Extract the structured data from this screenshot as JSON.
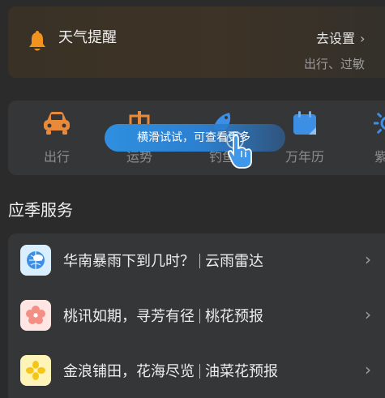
{
  "reminder": {
    "title": "天气提醒",
    "link_label": "去设置",
    "subtitle": "出行、过敏"
  },
  "tools": [
    {
      "label": "出行",
      "icon": "car-icon",
      "color": "#e98a3a"
    },
    {
      "label": "运势",
      "icon": "fortune-icon",
      "color": "#e98a3a"
    },
    {
      "label": "钓鱼",
      "icon": "fishing-icon",
      "color": "#3d8fe6"
    },
    {
      "label": "万年历",
      "icon": "calendar-icon",
      "color": "#3d8fe6"
    },
    {
      "label": "紫外",
      "icon": "uv-sun-icon",
      "color": "#3d8fe6"
    }
  ],
  "scroll_hint": "横滑试试，可查看更多",
  "seasonal": {
    "title": "应季服务",
    "items": [
      {
        "main": "华南暴雨下到几时？",
        "tag": "云雨雷达",
        "icon": "cloud-radar-icon",
        "bg": "#d9efff"
      },
      {
        "main": "桃讯如期，寻芳有径",
        "tag": "桃花预报",
        "icon": "peach-blossom-icon",
        "bg": "#ffe6e3"
      },
      {
        "main": "金浪铺田，花海尽览",
        "tag": "油菜花预报",
        "icon": "rapeseed-flower-icon",
        "bg": "#fff4b8"
      }
    ]
  }
}
